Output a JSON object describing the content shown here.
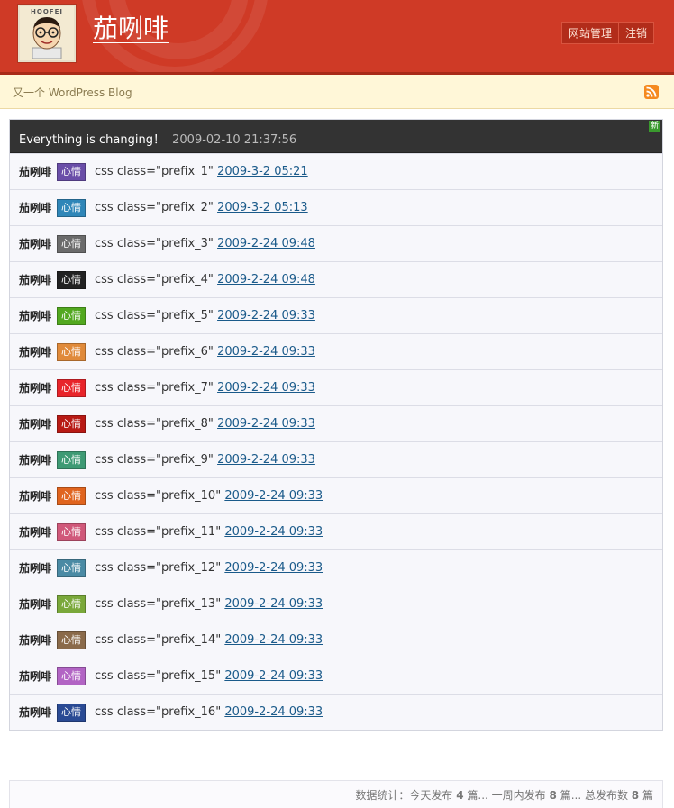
{
  "header": {
    "avatar_caption": "HOOFEI",
    "site_title": "茄咧啡",
    "admin_links": [
      "网站管理",
      "注销"
    ]
  },
  "tagbar": {
    "tagline": "又一个 WordPress Blog",
    "rss_icon": "rss-icon"
  },
  "feed": {
    "title": "Everything is changing！",
    "time": "2009-02-10 21:37:56",
    "new_badge": "新",
    "items": [
      {
        "author": "茄咧啡",
        "tag": "心情",
        "color": "#6a4ea8",
        "text": "css class=\"prefix_1\"",
        "date": "2009-3-2 05:21"
      },
      {
        "author": "茄咧啡",
        "tag": "心情",
        "color": "#2f86b8",
        "text": "css class=\"prefix_2\"",
        "date": "2009-3-2 05:13"
      },
      {
        "author": "茄咧啡",
        "tag": "心情",
        "color": "#6b6b6b",
        "text": "css class=\"prefix_3\"",
        "date": "2009-2-24 09:48"
      },
      {
        "author": "茄咧啡",
        "tag": "心情",
        "color": "#222222",
        "text": "css class=\"prefix_4\"",
        "date": "2009-2-24 09:48"
      },
      {
        "author": "茄咧啡",
        "tag": "心情",
        "color": "#52a81f",
        "text": "css class=\"prefix_5\"",
        "date": "2009-2-24 09:33"
      },
      {
        "author": "茄咧啡",
        "tag": "心情",
        "color": "#e08a3a",
        "text": "css class=\"prefix_6\"",
        "date": "2009-2-24 09:33"
      },
      {
        "author": "茄咧啡",
        "tag": "心情",
        "color": "#e8242a",
        "text": "css class=\"prefix_7\"",
        "date": "2009-2-24 09:33"
      },
      {
        "author": "茄咧啡",
        "tag": "心情",
        "color": "#b81a14",
        "text": "css class=\"prefix_8\"",
        "date": "2009-2-24 09:33"
      },
      {
        "author": "茄咧啡",
        "tag": "心情",
        "color": "#3e9a74",
        "text": "css class=\"prefix_9\"",
        "date": "2009-2-24 09:33"
      },
      {
        "author": "茄咧啡",
        "tag": "心情",
        "color": "#e0641e",
        "text": "css class=\"prefix_10\"",
        "date": "2009-2-24 09:33"
      },
      {
        "author": "茄咧啡",
        "tag": "心情",
        "color": "#d0587a",
        "text": "css class=\"prefix_11\"",
        "date": "2009-2-24 09:33"
      },
      {
        "author": "茄咧啡",
        "tag": "心情",
        "color": "#4a8aa4",
        "text": "css class=\"prefix_12\"",
        "date": "2009-2-24 09:33"
      },
      {
        "author": "茄咧啡",
        "tag": "心情",
        "color": "#7aa83a",
        "text": "css class=\"prefix_13\"",
        "date": "2009-2-24 09:33"
      },
      {
        "author": "茄咧啡",
        "tag": "心情",
        "color": "#8a6a4a",
        "text": "css class=\"prefix_14\"",
        "date": "2009-2-24 09:33"
      },
      {
        "author": "茄咧啡",
        "tag": "心情",
        "color": "#b264c4",
        "text": "css class=\"prefix_15\"",
        "date": "2009-2-24 09:33"
      },
      {
        "author": "茄咧啡",
        "tag": "心情",
        "color": "#2a4a94",
        "text": "css class=\"prefix_16\"",
        "date": "2009-2-24 09:33"
      }
    ]
  },
  "stats": {
    "prefix": "数据统计：今天发布",
    "today": "4",
    "unit1": "篇... 一周内发布",
    "week": "8",
    "unit2": "篇... 总发布数",
    "total": "8",
    "unit3": "篇"
  }
}
